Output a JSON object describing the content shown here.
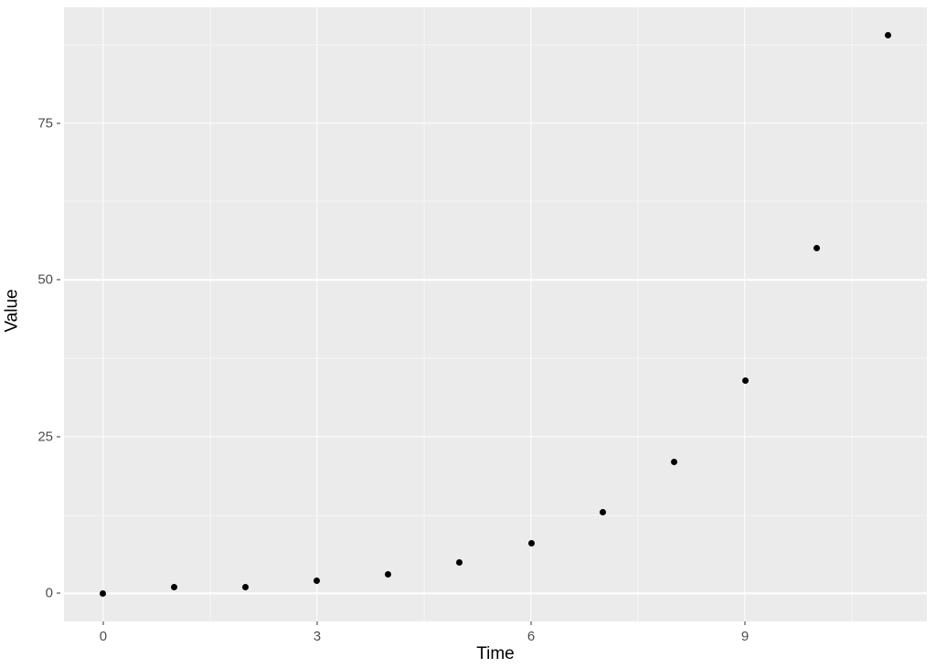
{
  "chart_data": {
    "type": "scatter",
    "xlabel": "Time",
    "ylabel": "Value",
    "x": [
      0,
      1,
      2,
      3,
      4,
      5,
      6,
      7,
      8,
      9,
      10,
      11
    ],
    "y": [
      0,
      1,
      1,
      2,
      3,
      5,
      8,
      13,
      21,
      34,
      55,
      89
    ],
    "x_ticks": [
      0,
      3,
      6,
      9
    ],
    "y_ticks": [
      0,
      25,
      50,
      75
    ],
    "x_minor": [
      1.5,
      4.5,
      7.5,
      10.5
    ],
    "y_minor": [
      12.5,
      37.5,
      62.5,
      87.5
    ],
    "xlim": [
      -0.55,
      11.55
    ],
    "ylim": [
      -4.45,
      93.45
    ]
  }
}
